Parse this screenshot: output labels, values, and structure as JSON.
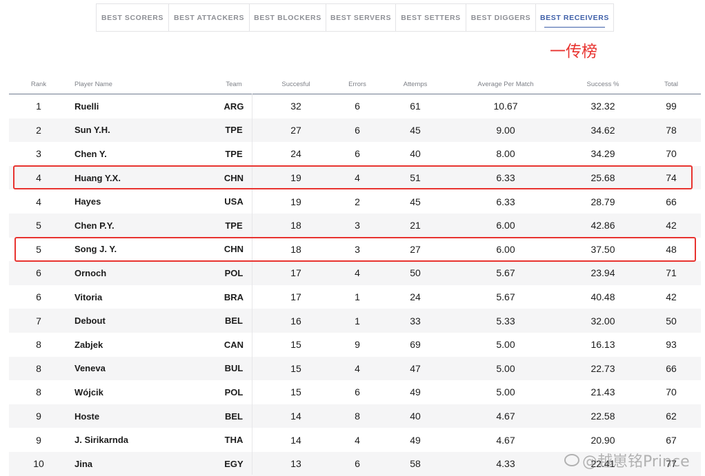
{
  "tabs": [
    {
      "label": "BEST SCORERS",
      "active": false
    },
    {
      "label": "BEST ATTACKERS",
      "active": false
    },
    {
      "label": "BEST BLOCKERS",
      "active": false
    },
    {
      "label": "BEST SERVERS",
      "active": false
    },
    {
      "label": "BEST SETTERS",
      "active": false
    },
    {
      "label": "BEST DIGGERS",
      "active": false
    },
    {
      "label": "BEST RECEIVERS",
      "active": true
    }
  ],
  "annotation": {
    "text": "一传榜",
    "color": "#e8332f"
  },
  "table": {
    "headers": {
      "rank": "Rank",
      "player": "Player Name",
      "team": "Team",
      "successful": "Succesful",
      "errors": "Errors",
      "attempts": "Attemps",
      "avg": "Average Per Match",
      "success_pct": "Success %",
      "total": "Total"
    },
    "rows": [
      {
        "rank": "1",
        "player": "Ruelli",
        "team": "ARG",
        "successful": "32",
        "errors": "6",
        "attempts": "61",
        "avg": "10.67",
        "success_pct": "32.32",
        "total": "99"
      },
      {
        "rank": "2",
        "player": "Sun Y.H.",
        "team": "TPE",
        "successful": "27",
        "errors": "6",
        "attempts": "45",
        "avg": "9.00",
        "success_pct": "34.62",
        "total": "78"
      },
      {
        "rank": "3",
        "player": "Chen Y.",
        "team": "TPE",
        "successful": "24",
        "errors": "6",
        "attempts": "40",
        "avg": "8.00",
        "success_pct": "34.29",
        "total": "70"
      },
      {
        "rank": "4",
        "player": "Huang Y.X.",
        "team": "CHN",
        "successful": "19",
        "errors": "4",
        "attempts": "51",
        "avg": "6.33",
        "success_pct": "25.68",
        "total": "74"
      },
      {
        "rank": "4",
        "player": "Hayes",
        "team": "USA",
        "successful": "19",
        "errors": "2",
        "attempts": "45",
        "avg": "6.33",
        "success_pct": "28.79",
        "total": "66"
      },
      {
        "rank": "5",
        "player": "Chen P.Y.",
        "team": "TPE",
        "successful": "18",
        "errors": "3",
        "attempts": "21",
        "avg": "6.00",
        "success_pct": "42.86",
        "total": "42"
      },
      {
        "rank": "5",
        "player": "Song J. Y.",
        "team": "CHN",
        "successful": "18",
        "errors": "3",
        "attempts": "27",
        "avg": "6.00",
        "success_pct": "37.50",
        "total": "48"
      },
      {
        "rank": "6",
        "player": "Ornoch",
        "team": "POL",
        "successful": "17",
        "errors": "4",
        "attempts": "50",
        "avg": "5.67",
        "success_pct": "23.94",
        "total": "71"
      },
      {
        "rank": "6",
        "player": "Vitoria",
        "team": "BRA",
        "successful": "17",
        "errors": "1",
        "attempts": "24",
        "avg": "5.67",
        "success_pct": "40.48",
        "total": "42"
      },
      {
        "rank": "7",
        "player": "Debout",
        "team": "BEL",
        "successful": "16",
        "errors": "1",
        "attempts": "33",
        "avg": "5.33",
        "success_pct": "32.00",
        "total": "50"
      },
      {
        "rank": "8",
        "player": "Zabjek",
        "team": "CAN",
        "successful": "15",
        "errors": "9",
        "attempts": "69",
        "avg": "5.00",
        "success_pct": "16.13",
        "total": "93"
      },
      {
        "rank": "8",
        "player": "Veneva",
        "team": "BUL",
        "successful": "15",
        "errors": "4",
        "attempts": "47",
        "avg": "5.00",
        "success_pct": "22.73",
        "total": "66"
      },
      {
        "rank": "8",
        "player": "Wójcik",
        "team": "POL",
        "successful": "15",
        "errors": "6",
        "attempts": "49",
        "avg": "5.00",
        "success_pct": "21.43",
        "total": "70"
      },
      {
        "rank": "9",
        "player": "Hoste",
        "team": "BEL",
        "successful": "14",
        "errors": "8",
        "attempts": "40",
        "avg": "4.67",
        "success_pct": "22.58",
        "total": "62"
      },
      {
        "rank": "9",
        "player": "J. Sirikarnda",
        "team": "THA",
        "successful": "14",
        "errors": "4",
        "attempts": "49",
        "avg": "4.67",
        "success_pct": "20.90",
        "total": "67"
      },
      {
        "rank": "10",
        "player": "Jina",
        "team": "EGY",
        "successful": "13",
        "errors": "6",
        "attempts": "58",
        "avg": "4.33",
        "success_pct": "22.41",
        "total": "77"
      }
    ],
    "highlighted_players": [
      "Huang Y.X.",
      "Song J. Y."
    ],
    "highlight_color": "#e8332f"
  },
  "watermark": {
    "text": "@越崽铭Prince"
  }
}
